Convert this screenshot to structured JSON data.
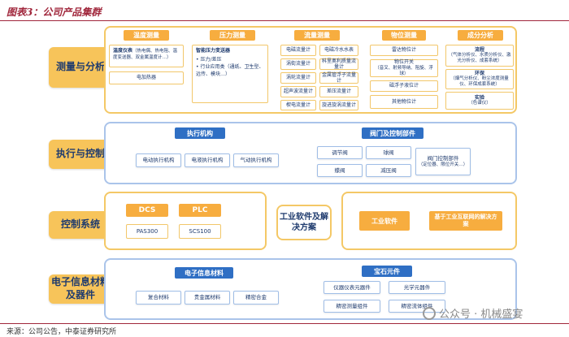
{
  "header": {
    "title": "图表3：公司产品集群"
  },
  "footer": {
    "source": "来源：公司公告，中泰证券研究所",
    "watermark": "公众号 · 机械盛宴"
  },
  "row1": {
    "category": "测量与分析",
    "temperature": {
      "header": "温度测量",
      "item1_title": "温度仪表",
      "item1_sub": "（热电偶、热电阻、温度变送器、双金属温度计…）",
      "item2": "电加热器"
    },
    "pressure": {
      "header": "压力测量",
      "title": "智能压力变送器",
      "items": [
        "压力/差压",
        "行业应用类（通纸、卫生型、远传、模块…）"
      ]
    },
    "flow": {
      "header": "流量测量",
      "items": [
        "电磁流量计",
        "电磁冷水水表",
        "涡街流量计",
        "科里奥利质量流量计",
        "涡轮流量计",
        "金属管浮子流量计",
        "超声波流量计",
        "差压流量计",
        "楔电流量计",
        "旋进旋涡流量计"
      ]
    },
    "level": {
      "header": "物位测量",
      "items": [
        "雷达物位计",
        "物位开关",
        "磁浮子液位计",
        "其他物位计"
      ],
      "switch_sub": "（音叉、射频导纳、阻旋、浮球）"
    },
    "analysis": {
      "header": "成分分析",
      "items": [
        "流程",
        "环保",
        "实验"
      ],
      "subs": [
        "（气体分析仪、水质分析仪、激光分析仪、成套系统）",
        "（烟气分析仪、粉尘浓度测量仪、环保成套系统）",
        "（色谱仪）"
      ]
    }
  },
  "row2": {
    "category": "执行与控制",
    "actuator": {
      "header": "执行机构",
      "items": [
        "电动执行机构",
        "电液执行机构",
        "气动执行机构"
      ]
    },
    "valve": {
      "header": "阀门及控制部件",
      "items": [
        "调节阀",
        "球阀",
        "蝶阀",
        "减压阀"
      ],
      "control_title": "阀门控制部件",
      "control_sub": "（定位器、限位开关…）"
    }
  },
  "row3": {
    "category": "控制系统",
    "dcs": {
      "header": "DCS",
      "item": "PAS300"
    },
    "plc": {
      "header": "PLC",
      "item": "SCS100"
    },
    "software_title": "工业软件及解决方案",
    "software": {
      "item1": "工业软件",
      "item2": "基于工业互联网的解决方案"
    }
  },
  "row4": {
    "category": "电子信息材料及器件",
    "materials": {
      "header": "电子信息材料",
      "items": [
        "复合材料",
        "贵金属材料",
        "精密合金"
      ]
    },
    "gems": {
      "header": "宝石元件",
      "items": [
        "仪器仪表元器件",
        "光学元器件",
        "精密测量组件",
        "精密流体组件"
      ]
    }
  }
}
